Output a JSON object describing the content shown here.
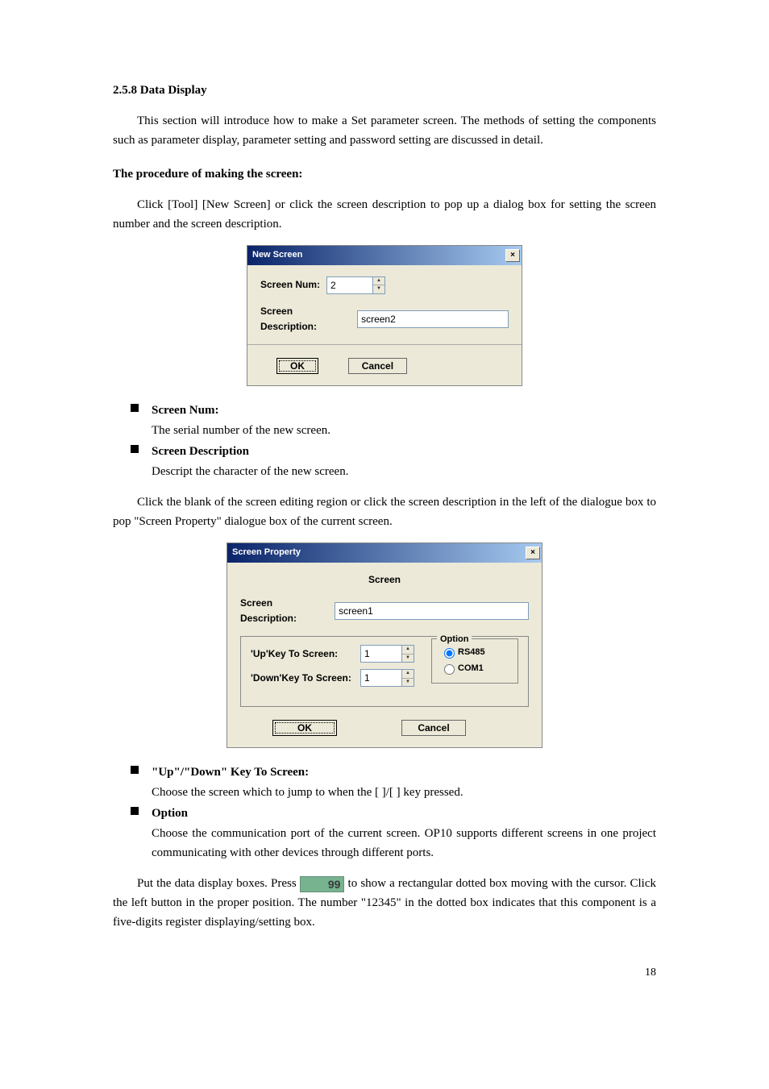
{
  "heading": "2.5.8 Data Display",
  "intro": "This section will introduce how to make a Set parameter screen. The methods of setting the components such as parameter display, parameter setting and password setting are discussed in detail.",
  "procedure_heading": "The procedure of making the screen:",
  "procedure_para": "Click [Tool]   [New Screen] or click the screen description to pop up a dialog box for setting the screen number and the screen description.",
  "dialog1": {
    "title": "New Screen",
    "screen_num_label": "Screen Num:",
    "screen_num_value": "2",
    "screen_desc_label": "Screen Description:",
    "screen_desc_value": "screen2",
    "ok": "OK",
    "cancel": "Cancel"
  },
  "bullets1": [
    {
      "term": "Screen Num:",
      "desc": "The serial number of the new screen."
    },
    {
      "term": "Screen Description",
      "desc": "Descript the character of the new screen."
    }
  ],
  "mid_para": "Click the blank of the screen editing region or click the screen description in the left of the dialogue box to pop \"Screen Property\" dialogue box of the current screen.",
  "dialog2": {
    "title": "Screen Property",
    "section": "Screen",
    "screen_desc_label": "Screen Description:",
    "screen_desc_value": "screen1",
    "up_label": "'Up'Key To Screen:",
    "up_value": "1",
    "down_label": "'Down'Key To Screen:",
    "down_value": "1",
    "option_label": "Option",
    "opt1": "RS485",
    "opt2": "COM1",
    "ok": "OK",
    "cancel": "Cancel"
  },
  "bullets2": [
    {
      "term": "\"Up\"/\"Down\" Key To Screen:",
      "desc": "Choose the screen which to jump to when the [    ]/[    ] key pressed."
    },
    {
      "term": "Option",
      "desc": "Choose the communication port of the current screen. OP10 supports different screens in one project communicating with other devices through different ports."
    }
  ],
  "final_para_a": "Put the data display boxes. Press ",
  "final_para_b": " to show a rectangular dotted box moving with the cursor. Click the left button in the proper position. The number \"12345\" in the dotted box indicates that this component is a five-digits register displaying/setting box.",
  "icon99": "99",
  "page_num": "18"
}
